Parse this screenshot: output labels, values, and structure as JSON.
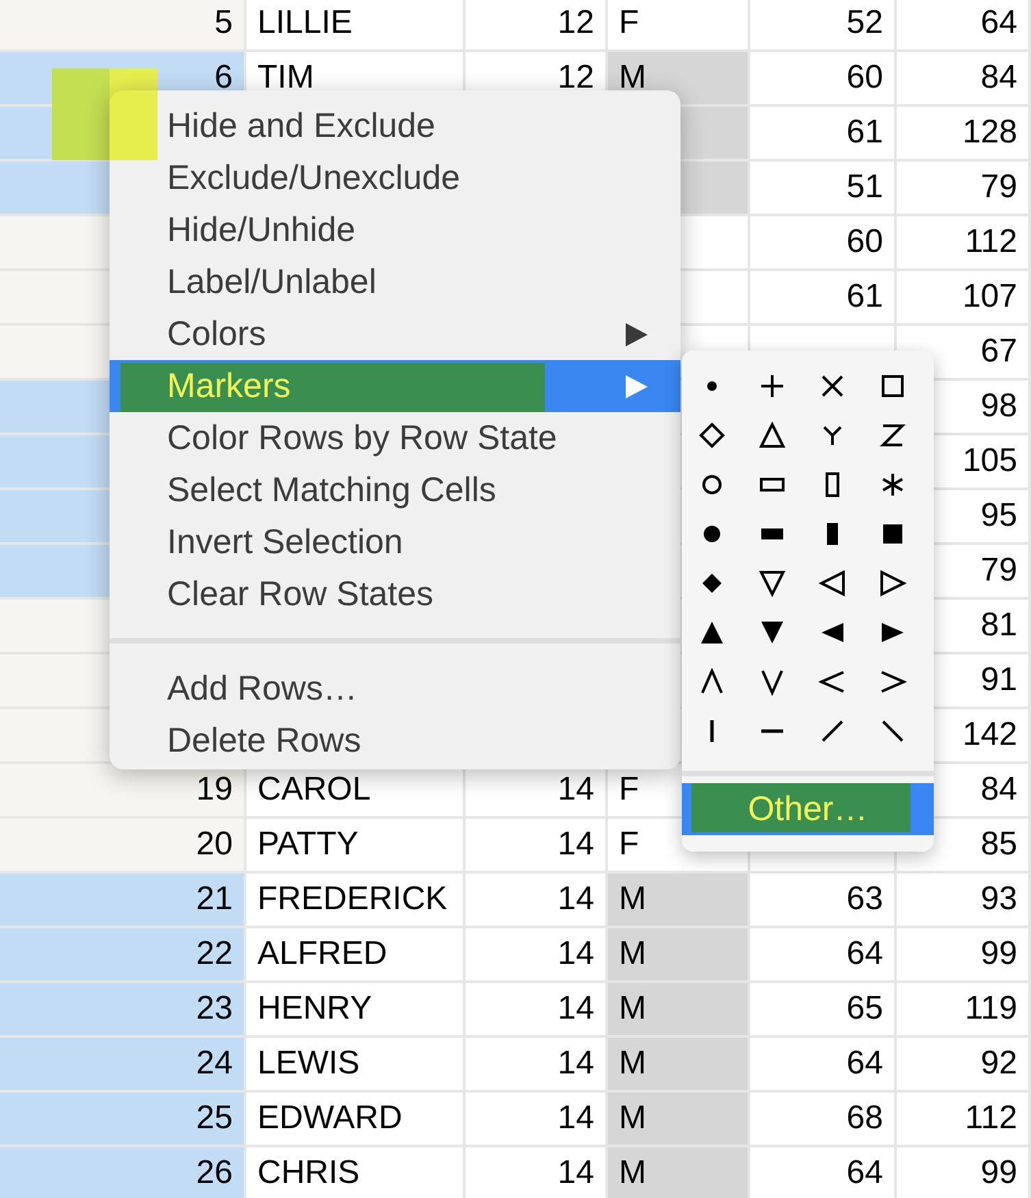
{
  "table": {
    "rows": [
      {
        "row": "5",
        "cells": [
          "LILLIE",
          "12",
          "F",
          "52",
          "64"
        ],
        "selected": false
      },
      {
        "row": "6",
        "cells": [
          "TIM",
          "12",
          "M",
          "60",
          "84"
        ],
        "selected": true
      },
      {
        "row": null,
        "cells": [
          null,
          null,
          "",
          "61",
          "128"
        ],
        "selected": true
      },
      {
        "row": null,
        "cells": [
          null,
          null,
          "",
          "51",
          "79"
        ],
        "selected": true
      },
      {
        "row": null,
        "cells": [
          null,
          null,
          "",
          "60",
          "112"
        ],
        "selected": false
      },
      {
        "row": null,
        "cells": [
          null,
          null,
          "",
          "61",
          "107"
        ],
        "selected": false
      },
      {
        "row": null,
        "cells": [
          null,
          null,
          "",
          "",
          "67"
        ],
        "selected": false
      },
      {
        "row": null,
        "cells": [
          null,
          null,
          null,
          null,
          "98"
        ],
        "selected": true
      },
      {
        "row": null,
        "cells": [
          null,
          null,
          null,
          null,
          "105"
        ],
        "selected": true
      },
      {
        "row": null,
        "cells": [
          null,
          null,
          null,
          null,
          "95"
        ],
        "selected": true
      },
      {
        "row": null,
        "cells": [
          null,
          null,
          null,
          null,
          "79"
        ],
        "selected": true
      },
      {
        "row": null,
        "cells": [
          null,
          null,
          null,
          null,
          "81"
        ],
        "selected": false
      },
      {
        "row": null,
        "cells": [
          null,
          null,
          null,
          null,
          "91"
        ],
        "selected": false
      },
      {
        "row": null,
        "cells": [
          null,
          null,
          null,
          null,
          "142"
        ],
        "selected": false
      },
      {
        "row": "19",
        "cells": [
          "CAROL",
          "14",
          "F",
          null,
          "84"
        ],
        "selected": false
      },
      {
        "row": "20",
        "cells": [
          "PATTY",
          "14",
          "F",
          "",
          "85"
        ],
        "selected": false
      },
      {
        "row": "21",
        "cells": [
          "FREDERICK",
          "14",
          "M",
          "63",
          "93"
        ],
        "selected": true
      },
      {
        "row": "22",
        "cells": [
          "ALFRED",
          "14",
          "M",
          "64",
          "99"
        ],
        "selected": true
      },
      {
        "row": "23",
        "cells": [
          "HENRY",
          "14",
          "M",
          "65",
          "119"
        ],
        "selected": true
      },
      {
        "row": "24",
        "cells": [
          "LEWIS",
          "14",
          "M",
          "64",
          "92"
        ],
        "selected": true
      },
      {
        "row": "25",
        "cells": [
          "EDWARD",
          "14",
          "M",
          "68",
          "112"
        ],
        "selected": true
      },
      {
        "row": "26",
        "cells": [
          "CHRIS",
          "14",
          "M",
          "64",
          "99"
        ],
        "selected": true
      }
    ]
  },
  "context_menu": {
    "groups": [
      [
        {
          "label": "Hide and Exclude",
          "submenu": false,
          "selected": false
        },
        {
          "label": "Exclude/Unexclude",
          "submenu": false,
          "selected": false
        },
        {
          "label": "Hide/Unhide",
          "submenu": false,
          "selected": false
        },
        {
          "label": "Label/Unlabel",
          "submenu": false,
          "selected": false
        },
        {
          "label": "Colors",
          "submenu": true,
          "selected": false
        },
        {
          "label": "Markers",
          "submenu": true,
          "selected": true
        },
        {
          "label": "Color Rows by Row State",
          "submenu": false,
          "selected": false
        },
        {
          "label": "Select Matching Cells",
          "submenu": false,
          "selected": false
        },
        {
          "label": "Invert Selection",
          "submenu": false,
          "selected": false
        },
        {
          "label": "Clear Row States",
          "submenu": false,
          "selected": false
        }
      ],
      [
        {
          "label": "Add Rows…",
          "submenu": false,
          "selected": false
        },
        {
          "label": "Delete Rows",
          "submenu": false,
          "selected": false
        }
      ]
    ]
  },
  "markers_submenu": {
    "markers": [
      {
        "kind": "dot"
      },
      {
        "kind": "plus"
      },
      {
        "kind": "cross"
      },
      {
        "kind": "square-open"
      },
      {
        "kind": "diamond-open"
      },
      {
        "kind": "triangle-open"
      },
      {
        "kind": "y-shape"
      },
      {
        "kind": "z-shape"
      },
      {
        "kind": "circle-open"
      },
      {
        "kind": "wide-rect-open"
      },
      {
        "kind": "tall-rect-open"
      },
      {
        "kind": "asterisk"
      },
      {
        "kind": "circle-filled"
      },
      {
        "kind": "wide-rect-filled"
      },
      {
        "kind": "tall-rect-filled"
      },
      {
        "kind": "square-filled"
      },
      {
        "kind": "diamond-filled"
      },
      {
        "kind": "down-triangle-open"
      },
      {
        "kind": "left-triangle-open"
      },
      {
        "kind": "right-triangle-open"
      },
      {
        "kind": "triangle-filled"
      },
      {
        "kind": "down-triangle-filled"
      },
      {
        "kind": "left-triangle-filled"
      },
      {
        "kind": "right-triangle-filled"
      },
      {
        "kind": "up-chevron"
      },
      {
        "kind": "down-chevron"
      },
      {
        "kind": "left-chevron"
      },
      {
        "kind": "right-chevron"
      },
      {
        "kind": "vertical-line"
      },
      {
        "kind": "horizontal-line"
      },
      {
        "kind": "slash-line"
      },
      {
        "kind": "backslash-line"
      }
    ],
    "items": [
      {
        "label": "Other…",
        "selected": true
      }
    ]
  }
}
